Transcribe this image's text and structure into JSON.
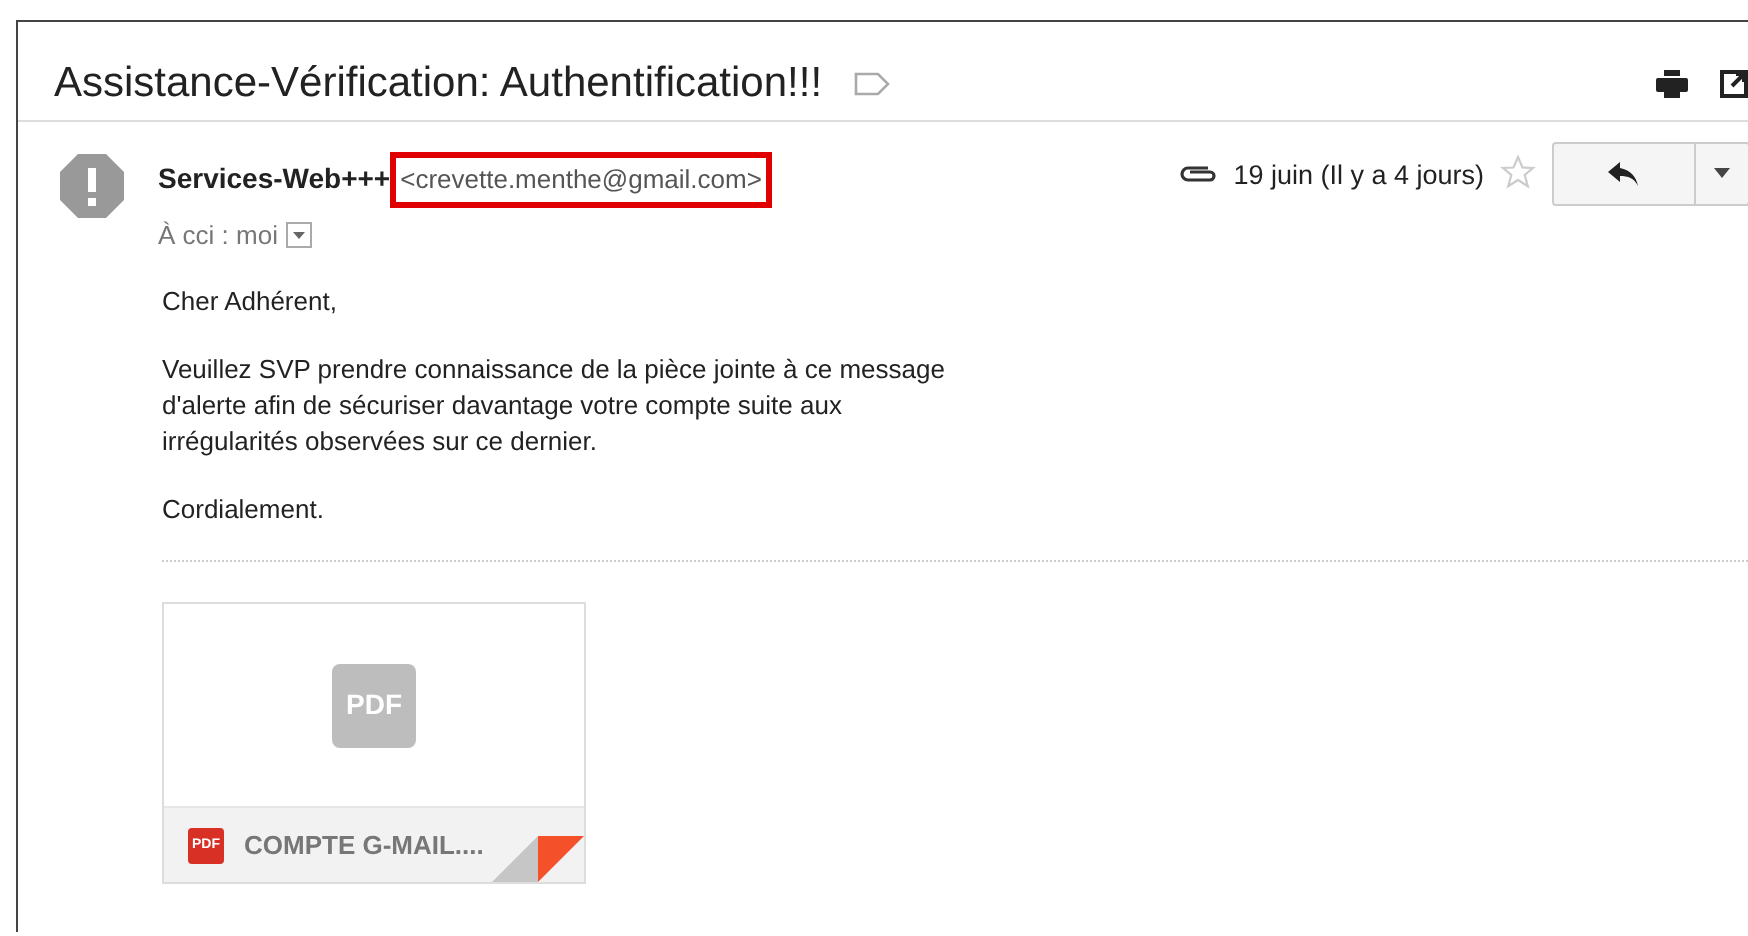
{
  "subject": "Assistance-Vérification: Authentification!!!",
  "sender": {
    "name": "Services-Web+++",
    "email": "<crevette.menthe@gmail.com>",
    "highlighted": true
  },
  "recipient": "À cci : moi",
  "date": "19 juin (Il y a 4 jours)",
  "starred": false,
  "has_attachment": true,
  "body": [
    "Cher Adhérent,",
    "Veuillez SVP prendre connaissance de la pièce jointe à ce message\nd'alerte afin de sécuriser davantage votre compte suite aux\nirrégularités observées sur ce dernier.",
    "Cordialement."
  ],
  "attachment": {
    "kind": "pdf",
    "thumb_label": "PDF",
    "icon_label": "PDF",
    "name": "COMPTE G-MAIL...."
  }
}
